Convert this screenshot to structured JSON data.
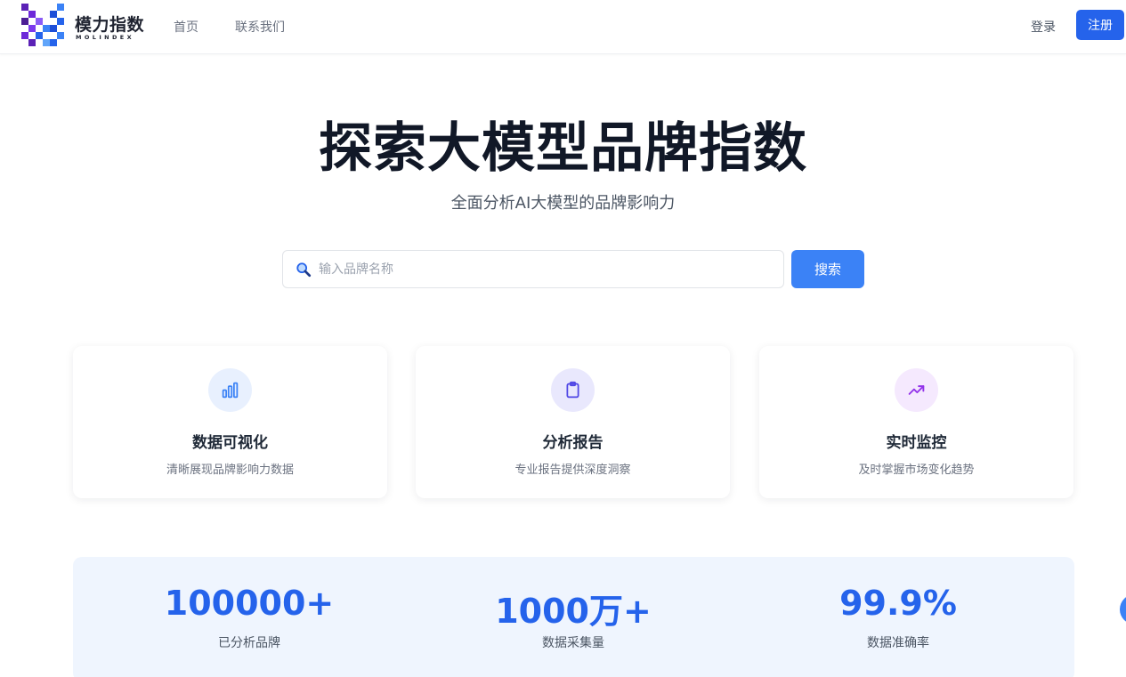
{
  "header": {
    "logo": {
      "name": "模力指数",
      "sub": "MOLINDEX"
    },
    "nav": [
      {
        "label": "首页"
      },
      {
        "label": "联系我们"
      }
    ],
    "login_label": "登录",
    "register_label": "注册"
  },
  "hero": {
    "title": "探索大模型品牌指数",
    "subtitle": "全面分析AI大模型的品牌影响力"
  },
  "search": {
    "placeholder": "输入品牌名称",
    "button_label": "搜索"
  },
  "features": [
    {
      "icon": "bar-chart-icon",
      "title": "数据可视化",
      "desc": "清晰展现品牌影响力数据",
      "accent": "#3b82f6",
      "bg": "#e8f0fe"
    },
    {
      "icon": "clipboard-icon",
      "title": "分析报告",
      "desc": "专业报告提供深度洞察",
      "accent": "#4f46e5",
      "bg": "#e9e8fd"
    },
    {
      "icon": "trending-up-icon",
      "title": "实时监控",
      "desc": "及时掌握市场变化趋势",
      "accent": "#9333ea",
      "bg": "#f5e9fe"
    }
  ],
  "stats": [
    {
      "value": "100000+",
      "label": "已分析品牌"
    },
    {
      "value": "1000万+",
      "label": "数据采集量"
    },
    {
      "value": "99.9%",
      "label": "数据准确率"
    }
  ],
  "colors": {
    "primary": "#2563eb",
    "search_button": "#3b82f6",
    "stats_bg": "#eff5fe"
  }
}
